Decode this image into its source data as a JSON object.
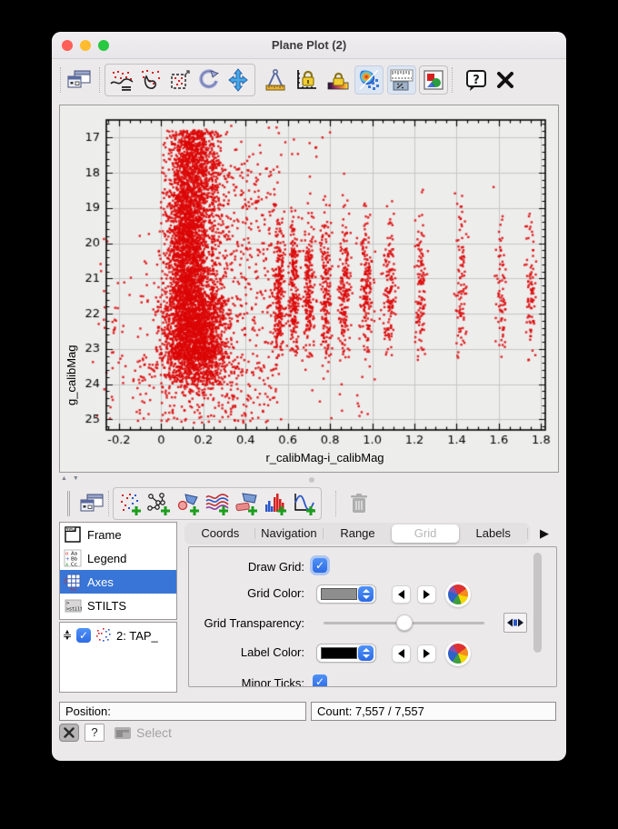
{
  "window": {
    "title": "Plane Plot (2)"
  },
  "toolbar_main": {
    "icons": [
      "plot-windows",
      "draw-subset-blob",
      "draw-subset-region",
      "resize-to-fit",
      "replot",
      "pan",
      "measure-distance",
      "lock-axes",
      "lock-aux-range",
      "sketch-mode",
      "aux-axis-control",
      "export-plot",
      "help",
      "close"
    ]
  },
  "toolbar_layers": {
    "icons": [
      "layer-controls",
      "add-position-layer",
      "add-pair-layer",
      "add-area-layer",
      "add-spectrogram-layer",
      "add-shape-layer",
      "add-histogram-layer",
      "add-function-layer",
      "remove-layer"
    ]
  },
  "sidebar": {
    "items": [
      {
        "label": "Frame",
        "selected": false
      },
      {
        "label": "Legend",
        "selected": false
      },
      {
        "label": "Axes",
        "selected": true
      },
      {
        "label": "STILTS",
        "selected": false
      }
    ],
    "layer": {
      "label": "2: TAP_",
      "checked": true
    }
  },
  "tabs": {
    "items": [
      {
        "label": "Coords",
        "selected": false
      },
      {
        "label": "Navigation",
        "selected": false
      },
      {
        "label": "Range",
        "selected": false
      },
      {
        "label": "Grid",
        "selected": true
      },
      {
        "label": "Labels",
        "selected": false
      }
    ],
    "overflow_arrow": "▶"
  },
  "grid_panel": {
    "draw_grid_label": "Draw Grid:",
    "draw_grid_checked": true,
    "grid_color_label": "Grid Color:",
    "grid_color_value": "#8e8e8e",
    "grid_transparency_label": "Grid Transparency:",
    "grid_transparency_percent": 50,
    "label_color_label": "Label Color:",
    "label_color_value": "#000000",
    "minor_ticks_label": "Minor Ticks:",
    "minor_ticks_checked": true
  },
  "status": {
    "position_label": "Position:",
    "count_text": "Count: 7,557 / 7,557"
  },
  "footer": {
    "select_label": "Select"
  },
  "colors": {
    "accent": "#2e6be5",
    "selection": "#3875d7",
    "marker": "#dc0606"
  },
  "chart_data": {
    "type": "scatter",
    "title": "",
    "xlabel": "r_calibMag-i_calibMag",
    "ylabel": "g_calibMag",
    "xlim": [
      -0.26,
      1.82
    ],
    "ylim": [
      25.3,
      16.5
    ],
    "xtick_values": [
      -0.2,
      0,
      0.2,
      0.4,
      0.6,
      0.8,
      1.0,
      1.2,
      1.4,
      1.6,
      1.8
    ],
    "xtick_labels": [
      "-0.2",
      "0",
      "0.2",
      "0.4",
      "0.6",
      "0.8",
      "1.0",
      "1.2",
      "1.4",
      "1.6",
      "1.8"
    ],
    "ytick_values": [
      17,
      18,
      19,
      20,
      21,
      22,
      23,
      24,
      25
    ],
    "x_minor_step": 0.05,
    "y_minor_step": 0.2,
    "grid": true,
    "grid_color": "#c6c6c6",
    "frame_color": "#000000",
    "marker_color": "#dc0606",
    "marker_size": 2.4,
    "total_count": 7557,
    "seed": 42,
    "clusters": [
      {
        "shape": "gxuy",
        "n": 900,
        "x_mu": 0.15,
        "x_sigma": 0.06,
        "x_min": 0.0,
        "x_max": 0.38,
        "y_min": 16.8,
        "y_max": 18.5
      },
      {
        "shape": "gxuy",
        "n": 1900,
        "x_mu": 0.13,
        "x_sigma": 0.05,
        "x_min": -0.02,
        "x_max": 0.4,
        "y_min": 18.5,
        "y_max": 21.5
      },
      {
        "shape": "gxuy",
        "n": 1900,
        "x_mu": 0.15,
        "x_sigma": 0.07,
        "x_min": -0.03,
        "x_max": 0.45,
        "y_min": 21.5,
        "y_max": 23.3
      },
      {
        "shape": "gxy",
        "n": 450,
        "x_mu": 0.16,
        "x_sigma": 0.08,
        "y_mu": 23.6,
        "y_sigma": 0.3,
        "x_min": -0.1,
        "x_max": 0.5,
        "y_min": 23.1,
        "y_max": 24.6
      },
      {
        "shape": "uni",
        "n": 260,
        "x_min": -0.12,
        "x_max": 0.55,
        "y_min": 23.3,
        "y_max": 25.1
      },
      {
        "shape": "pxu",
        "n": 520,
        "x_base": 0.24,
        "x_scale": 0.32,
        "x_pow": 2,
        "y_min": 17.6,
        "y_max": 23.2
      },
      {
        "shape": "uni",
        "n": 150,
        "x_min": -0.33,
        "x_max": 1.02,
        "y_min": 19.2,
        "y_max": 25.0
      },
      {
        "shape": "uni",
        "n": 40,
        "x_min": -0.3,
        "x_max": 0.0,
        "y_min": 19.5,
        "y_max": 24.5
      },
      {
        "shape": "uni",
        "n": 25,
        "x_min": 0.2,
        "x_max": 0.8,
        "y_min": 16.65,
        "y_max": 17.6
      }
    ],
    "stripes": {
      "x": [
        0.56,
        0.63,
        0.7,
        0.78,
        0.87,
        0.97,
        1.08,
        1.23,
        1.42,
        1.61,
        1.75
      ],
      "n": [
        240,
        220,
        200,
        185,
        175,
        165,
        145,
        120,
        95,
        75,
        85
      ],
      "x_sigma": 0.013,
      "y_mu": 21.4,
      "y_sigma": 1.15,
      "y_min": 18.0,
      "y_max": 23.35
    }
  }
}
